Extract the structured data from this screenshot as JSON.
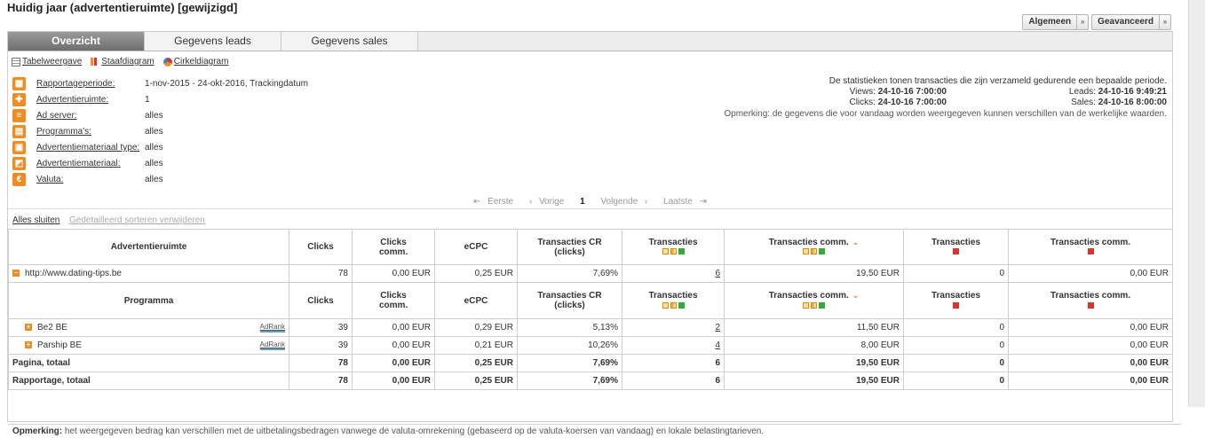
{
  "page": {
    "title": "Huidig jaar (advertentieruimte) [gewijzigd]"
  },
  "top_buttons": [
    {
      "label": "Algemeen",
      "arrow": "»"
    },
    {
      "label": "Geavanceerd",
      "arrow": "»"
    }
  ],
  "tabs": [
    "Overzicht",
    "Gegevens leads",
    "Gegevens sales"
  ],
  "views": [
    "Tabelweergave",
    "Staafdiagram",
    "Cirkeldiagram"
  ],
  "filters": [
    {
      "label": "Rapportageperiode:",
      "value": "1-nov-2015 - 24-okt-2016, Trackingdatum",
      "icon": "calendar-icon"
    },
    {
      "label": "Advertentieruimte:",
      "value": "1",
      "icon": "adspace-icon"
    },
    {
      "label": "Ad server:",
      "value": "alles",
      "icon": "server-icon"
    },
    {
      "label": "Programma's:",
      "value": "alles",
      "icon": "program-icon"
    },
    {
      "label": "Advertentiemateriaal type:",
      "value": "alles",
      "icon": "material-type-icon"
    },
    {
      "label": "Advertentiemateriaal:",
      "value": "alles",
      "icon": "material-icon"
    },
    {
      "label": "Valuta:",
      "value": "alles",
      "icon": "euro-icon"
    }
  ],
  "stats": {
    "intro": "De statistieken tonen transacties die zijn verzameld gedurende een bepaalde periode.",
    "views_label": "Views:",
    "views_value": "24-10-16 7:00:00",
    "clicks_label": "Clicks:",
    "clicks_value": "24-10-16 7:00:00",
    "leads_label": "Leads:",
    "leads_value": "24-10-16 9:49:21",
    "sales_label": "Sales:",
    "sales_value": "24-10-16 8:00:00",
    "remark": "Opmerking: de gegevens die voor vandaag worden weergegeven kunnen verschillen van de werkelijke waarden."
  },
  "pager": {
    "first": "Eerste",
    "prev": "Vorige",
    "current": "1",
    "next": "Volgende",
    "last": "Laatste"
  },
  "sortbar": {
    "close_all": "Alles sluiten",
    "remove_sort": "Gedetailleerd sorteren verwijderen"
  },
  "table": {
    "headers": [
      "Advertentieruimte",
      "Clicks",
      "Clicks comm.",
      "eCPC",
      "Transacties CR (clicks)",
      "Transacties",
      "Transacties comm.",
      "Transacties",
      "Transacties comm."
    ],
    "sub_headers": [
      "Programma",
      "Clicks",
      "Clicks comm.",
      "eCPC",
      "Transacties CR (clicks)",
      "Transacties",
      "Transacties comm.",
      "Transacties",
      "Transacties comm."
    ],
    "adspace_row": {
      "name": "http://www.dating-tips.be",
      "clicks": "78",
      "clicks_comm": "0,00 EUR",
      "ecpc": "0,25 EUR",
      "cr": "7,69%",
      "trans": "6",
      "trans_comm": "19,50 EUR",
      "trans_r": "0",
      "trans_comm_r": "0,00 EUR"
    },
    "program_rows": [
      {
        "name": "Be2 BE",
        "adrank": "AdRank",
        "clicks": "39",
        "clicks_comm": "0,00 EUR",
        "ecpc": "0,29 EUR",
        "cr": "5,13%",
        "trans": "2",
        "trans_comm": "11,50 EUR",
        "trans_r": "0",
        "trans_comm_r": "0,00 EUR"
      },
      {
        "name": "Parship BE",
        "adrank": "AdRank",
        "clicks": "39",
        "clicks_comm": "0,00 EUR",
        "ecpc": "0,21 EUR",
        "cr": "10,26%",
        "trans": "4",
        "trans_comm": "8,00 EUR",
        "trans_r": "0",
        "trans_comm_r": "0,00 EUR"
      }
    ],
    "totals": [
      {
        "label": "Pagina, totaal",
        "clicks": "78",
        "clicks_comm": "0,00 EUR",
        "ecpc": "0,25 EUR",
        "cr": "7,69%",
        "trans": "6",
        "trans_comm": "19,50 EUR",
        "trans_r": "0",
        "trans_comm_r": "0,00 EUR"
      },
      {
        "label": "Rapportage, totaal",
        "clicks": "78",
        "clicks_comm": "0,00 EUR",
        "ecpc": "0,25 EUR",
        "cr": "7,69%",
        "trans": "6",
        "trans_comm": "19,50 EUR",
        "trans_r": "0",
        "trans_comm_r": "0,00 EUR"
      }
    ]
  },
  "note": {
    "label": "Opmerking:",
    "text": "het weergegeven bedrag kan verschillen met de uitbetalingsbedragen vanwege de valuta-omrekening (gebaseerd op de valuta-koersen van vandaag) en lokale belastingtarieven."
  },
  "colors": {
    "accent": "#f08c22",
    "green": "#39a83a",
    "red": "#e0322b",
    "tab_active": "#7d7d7d"
  }
}
